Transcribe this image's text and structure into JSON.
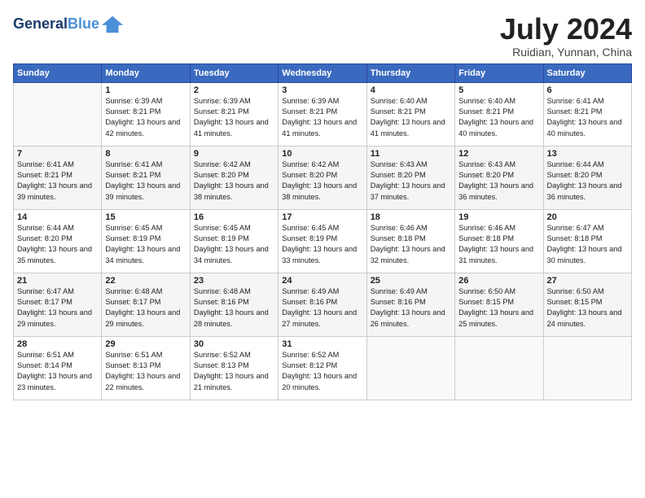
{
  "header": {
    "logo_line1": "General",
    "logo_line2": "Blue",
    "month": "July 2024",
    "location": "Ruidian, Yunnan, China"
  },
  "days_of_week": [
    "Sunday",
    "Monday",
    "Tuesday",
    "Wednesday",
    "Thursday",
    "Friday",
    "Saturday"
  ],
  "weeks": [
    [
      {
        "day": "",
        "sunrise": "",
        "sunset": "",
        "daylight": ""
      },
      {
        "day": "1",
        "sunrise": "Sunrise: 6:39 AM",
        "sunset": "Sunset: 8:21 PM",
        "daylight": "Daylight: 13 hours and 42 minutes."
      },
      {
        "day": "2",
        "sunrise": "Sunrise: 6:39 AM",
        "sunset": "Sunset: 8:21 PM",
        "daylight": "Daylight: 13 hours and 41 minutes."
      },
      {
        "day": "3",
        "sunrise": "Sunrise: 6:39 AM",
        "sunset": "Sunset: 8:21 PM",
        "daylight": "Daylight: 13 hours and 41 minutes."
      },
      {
        "day": "4",
        "sunrise": "Sunrise: 6:40 AM",
        "sunset": "Sunset: 8:21 PM",
        "daylight": "Daylight: 13 hours and 41 minutes."
      },
      {
        "day": "5",
        "sunrise": "Sunrise: 6:40 AM",
        "sunset": "Sunset: 8:21 PM",
        "daylight": "Daylight: 13 hours and 40 minutes."
      },
      {
        "day": "6",
        "sunrise": "Sunrise: 6:41 AM",
        "sunset": "Sunset: 8:21 PM",
        "daylight": "Daylight: 13 hours and 40 minutes."
      }
    ],
    [
      {
        "day": "7",
        "sunrise": "Sunrise: 6:41 AM",
        "sunset": "Sunset: 8:21 PM",
        "daylight": "Daylight: 13 hours and 39 minutes."
      },
      {
        "day": "8",
        "sunrise": "Sunrise: 6:41 AM",
        "sunset": "Sunset: 8:21 PM",
        "daylight": "Daylight: 13 hours and 39 minutes."
      },
      {
        "day": "9",
        "sunrise": "Sunrise: 6:42 AM",
        "sunset": "Sunset: 8:20 PM",
        "daylight": "Daylight: 13 hours and 38 minutes."
      },
      {
        "day": "10",
        "sunrise": "Sunrise: 6:42 AM",
        "sunset": "Sunset: 8:20 PM",
        "daylight": "Daylight: 13 hours and 38 minutes."
      },
      {
        "day": "11",
        "sunrise": "Sunrise: 6:43 AM",
        "sunset": "Sunset: 8:20 PM",
        "daylight": "Daylight: 13 hours and 37 minutes."
      },
      {
        "day": "12",
        "sunrise": "Sunrise: 6:43 AM",
        "sunset": "Sunset: 8:20 PM",
        "daylight": "Daylight: 13 hours and 36 minutes."
      },
      {
        "day": "13",
        "sunrise": "Sunrise: 6:44 AM",
        "sunset": "Sunset: 8:20 PM",
        "daylight": "Daylight: 13 hours and 36 minutes."
      }
    ],
    [
      {
        "day": "14",
        "sunrise": "Sunrise: 6:44 AM",
        "sunset": "Sunset: 8:20 PM",
        "daylight": "Daylight: 13 hours and 35 minutes."
      },
      {
        "day": "15",
        "sunrise": "Sunrise: 6:45 AM",
        "sunset": "Sunset: 8:19 PM",
        "daylight": "Daylight: 13 hours and 34 minutes."
      },
      {
        "day": "16",
        "sunrise": "Sunrise: 6:45 AM",
        "sunset": "Sunset: 8:19 PM",
        "daylight": "Daylight: 13 hours and 34 minutes."
      },
      {
        "day": "17",
        "sunrise": "Sunrise: 6:45 AM",
        "sunset": "Sunset: 8:19 PM",
        "daylight": "Daylight: 13 hours and 33 minutes."
      },
      {
        "day": "18",
        "sunrise": "Sunrise: 6:46 AM",
        "sunset": "Sunset: 8:18 PM",
        "daylight": "Daylight: 13 hours and 32 minutes."
      },
      {
        "day": "19",
        "sunrise": "Sunrise: 6:46 AM",
        "sunset": "Sunset: 8:18 PM",
        "daylight": "Daylight: 13 hours and 31 minutes."
      },
      {
        "day": "20",
        "sunrise": "Sunrise: 6:47 AM",
        "sunset": "Sunset: 8:18 PM",
        "daylight": "Daylight: 13 hours and 30 minutes."
      }
    ],
    [
      {
        "day": "21",
        "sunrise": "Sunrise: 6:47 AM",
        "sunset": "Sunset: 8:17 PM",
        "daylight": "Daylight: 13 hours and 29 minutes."
      },
      {
        "day": "22",
        "sunrise": "Sunrise: 6:48 AM",
        "sunset": "Sunset: 8:17 PM",
        "daylight": "Daylight: 13 hours and 29 minutes."
      },
      {
        "day": "23",
        "sunrise": "Sunrise: 6:48 AM",
        "sunset": "Sunset: 8:16 PM",
        "daylight": "Daylight: 13 hours and 28 minutes."
      },
      {
        "day": "24",
        "sunrise": "Sunrise: 6:49 AM",
        "sunset": "Sunset: 8:16 PM",
        "daylight": "Daylight: 13 hours and 27 minutes."
      },
      {
        "day": "25",
        "sunrise": "Sunrise: 6:49 AM",
        "sunset": "Sunset: 8:16 PM",
        "daylight": "Daylight: 13 hours and 26 minutes."
      },
      {
        "day": "26",
        "sunrise": "Sunrise: 6:50 AM",
        "sunset": "Sunset: 8:15 PM",
        "daylight": "Daylight: 13 hours and 25 minutes."
      },
      {
        "day": "27",
        "sunrise": "Sunrise: 6:50 AM",
        "sunset": "Sunset: 8:15 PM",
        "daylight": "Daylight: 13 hours and 24 minutes."
      }
    ],
    [
      {
        "day": "28",
        "sunrise": "Sunrise: 6:51 AM",
        "sunset": "Sunset: 8:14 PM",
        "daylight": "Daylight: 13 hours and 23 minutes."
      },
      {
        "day": "29",
        "sunrise": "Sunrise: 6:51 AM",
        "sunset": "Sunset: 8:13 PM",
        "daylight": "Daylight: 13 hours and 22 minutes."
      },
      {
        "day": "30",
        "sunrise": "Sunrise: 6:52 AM",
        "sunset": "Sunset: 8:13 PM",
        "daylight": "Daylight: 13 hours and 21 minutes."
      },
      {
        "day": "31",
        "sunrise": "Sunrise: 6:52 AM",
        "sunset": "Sunset: 8:12 PM",
        "daylight": "Daylight: 13 hours and 20 minutes."
      },
      {
        "day": "",
        "sunrise": "",
        "sunset": "",
        "daylight": ""
      },
      {
        "day": "",
        "sunrise": "",
        "sunset": "",
        "daylight": ""
      },
      {
        "day": "",
        "sunrise": "",
        "sunset": "",
        "daylight": ""
      }
    ]
  ]
}
